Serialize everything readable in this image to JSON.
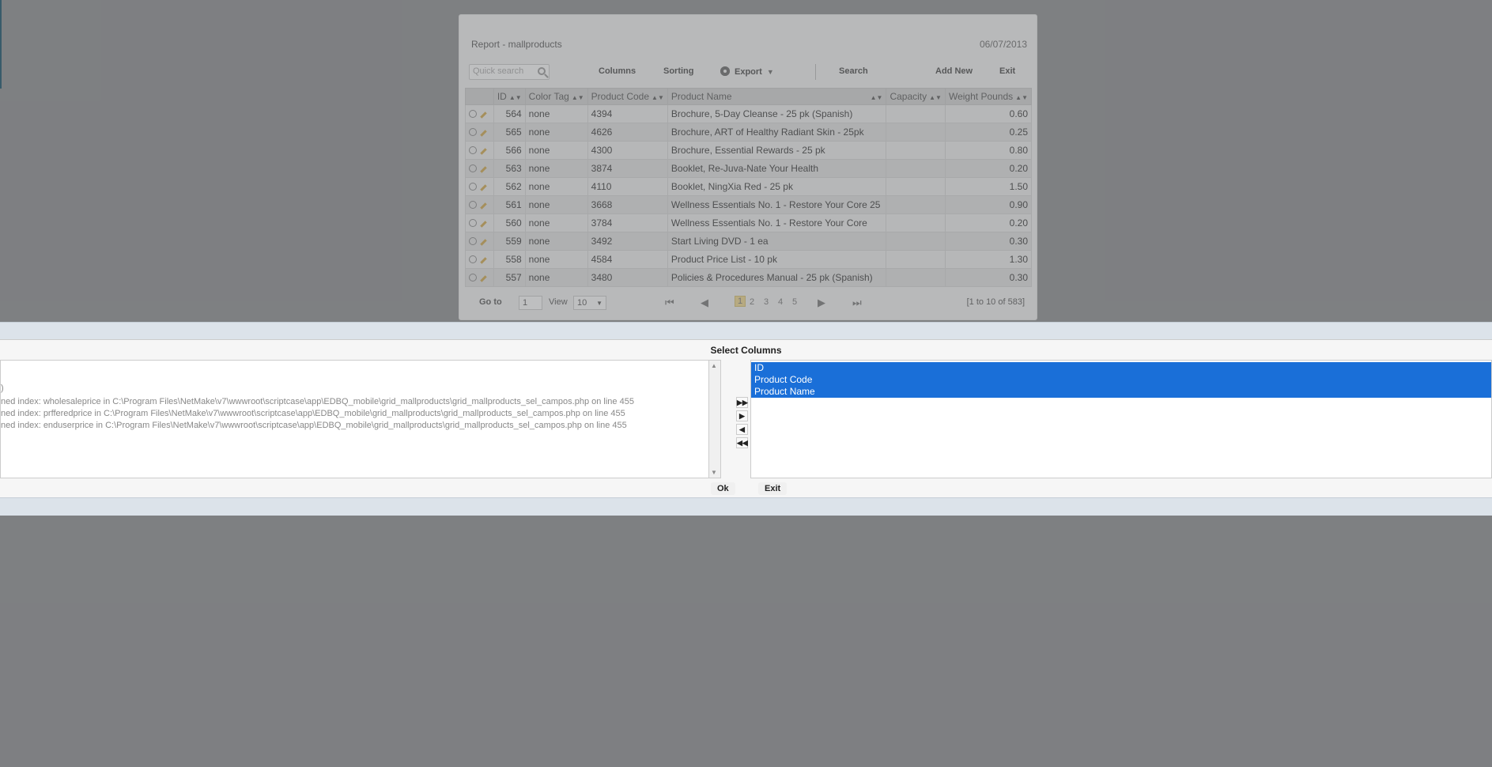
{
  "report": {
    "title": "Report - mallproducts",
    "date": "06/07/2013",
    "quick_search_placeholder": "Quick search",
    "toolbar": {
      "columns": "Columns",
      "sorting": "Sorting",
      "export": "Export",
      "search": "Search",
      "add_new": "Add New",
      "exit": "Exit"
    },
    "headers": [
      "ID",
      "Color Tag",
      "Product Code",
      "Product Name",
      "Capacity",
      "Weight Pounds"
    ],
    "rows": [
      {
        "id": "564",
        "color_tag": "none",
        "code": "4394",
        "name": "Brochure, 5-Day Cleanse - 25 pk (Spanish)",
        "capacity": "",
        "weight": "0.60"
      },
      {
        "id": "565",
        "color_tag": "none",
        "code": "4626",
        "name": "Brochure, ART of Healthy Radiant Skin - 25pk",
        "capacity": "",
        "weight": "0.25"
      },
      {
        "id": "566",
        "color_tag": "none",
        "code": "4300",
        "name": "Brochure, Essential Rewards - 25 pk",
        "capacity": "",
        "weight": "0.80"
      },
      {
        "id": "563",
        "color_tag": "none",
        "code": "3874",
        "name": "Booklet, Re-Juva-Nate Your Health",
        "capacity": "",
        "weight": "0.20"
      },
      {
        "id": "562",
        "color_tag": "none",
        "code": "4110",
        "name": "Booklet, NingXia Red - 25 pk",
        "capacity": "",
        "weight": "1.50"
      },
      {
        "id": "561",
        "color_tag": "none",
        "code": "3668",
        "name": "Wellness Essentials No. 1 - Restore Your Core 25",
        "capacity": "",
        "weight": "0.90"
      },
      {
        "id": "560",
        "color_tag": "none",
        "code": "3784",
        "name": "Wellness Essentials No. 1 - Restore Your Core",
        "capacity": "",
        "weight": "0.20"
      },
      {
        "id": "559",
        "color_tag": "none",
        "code": "3492",
        "name": "Start Living DVD - 1 ea",
        "capacity": "",
        "weight": "0.30"
      },
      {
        "id": "558",
        "color_tag": "none",
        "code": "4584",
        "name": "Product Price List - 10 pk",
        "capacity": "",
        "weight": "1.30"
      },
      {
        "id": "557",
        "color_tag": "none",
        "code": "3480",
        "name": "Policies & Procedures Manual - 25 pk (Spanish)",
        "capacity": "",
        "weight": "0.30"
      }
    ],
    "pager": {
      "goto_label": "Go to",
      "goto_value": "1",
      "view_label": "View",
      "view_value": "10",
      "pages": [
        "1",
        "2",
        "3",
        "4",
        "5"
      ],
      "active_page": "1",
      "summary": "[1 to 10 of 583]"
    }
  },
  "dialog": {
    "title": "Select Columns",
    "available_partial_first": ")",
    "warnings": [
      "ned index: wholesaleprice in C:\\Program Files\\NetMake\\v7\\wwwroot\\scriptcase\\app\\EDBQ_mobile\\grid_mallproducts\\grid_mallproducts_sel_campos.php on line 455",
      "ned index: prfferedprice in C:\\Program Files\\NetMake\\v7\\wwwroot\\scriptcase\\app\\EDBQ_mobile\\grid_mallproducts\\grid_mallproducts_sel_campos.php on line 455",
      "ned index: enduserprice in C:\\Program Files\\NetMake\\v7\\wwwroot\\scriptcase\\app\\EDBQ_mobile\\grid_mallproducts\\grid_mallproducts_sel_campos.php on line 455"
    ],
    "move_buttons": [
      "▶▶",
      "▶",
      "◀",
      "◀◀"
    ],
    "selected": [
      "ID",
      "Product Code",
      "Product Name"
    ],
    "ok_label": "Ok",
    "exit_label": "Exit"
  }
}
